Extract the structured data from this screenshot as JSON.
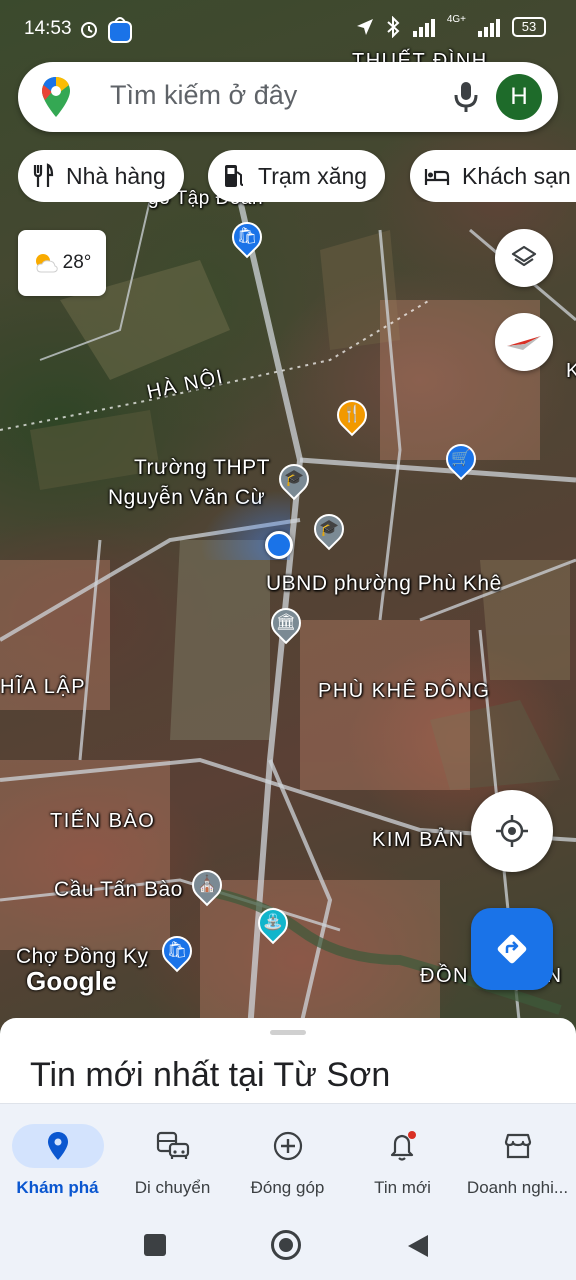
{
  "status_bar": {
    "time": "14:53",
    "network": "4G+",
    "battery": "53"
  },
  "search": {
    "placeholder": "Tìm kiếm ở đây",
    "avatar_letter": "H"
  },
  "chips": [
    {
      "label": "Nhà hàng",
      "icon": "restaurant-icon"
    },
    {
      "label": "Trạm xăng",
      "icon": "gas-station-icon"
    },
    {
      "label": "Khách sạn",
      "icon": "hotel-icon"
    }
  ],
  "weather": {
    "temperature": "28°",
    "icon": "partly-cloudy-icon"
  },
  "map": {
    "labels": {
      "thuet_binh": "THUẾT ĐÌNH",
      "go_tap_doan": "gỗ Tập Đoàn",
      "ha_noi": "HÀ NỘI",
      "school_line1": "Trường THPT",
      "school_line2": "Nguyễn Văn Cừ",
      "ubnd": "UBND phường Phù Khê",
      "nghia_lap": "HĨA LẬP",
      "phu_khe_dong": "PHÙ KHÊ ĐÔNG",
      "tien_bao": "TIẾN BÀO",
      "kim_bang": "KIM BẢN",
      "cau_tan_bao": "Cầu Tấn Bào",
      "cho_dong_ky": "Chợ Đồng Kỵ",
      "dong": "ĐỒN",
      "dong2": "ƠN",
      "edge_k": "K"
    },
    "google_logo": "Google"
  },
  "sheet": {
    "title": "Tin mới nhất tại Từ Sơn"
  },
  "nav": [
    {
      "label": "Khám phá",
      "icon": "explore-pin-icon",
      "active": true
    },
    {
      "label": "Di chuyển",
      "icon": "commute-icon",
      "active": false
    },
    {
      "label": "Đóng góp",
      "icon": "contribute-plus-icon",
      "active": false
    },
    {
      "label": "Tin mới",
      "icon": "notifications-bell-icon",
      "active": false
    },
    {
      "label": "Doanh nghi...",
      "icon": "business-store-icon",
      "active": false
    }
  ],
  "colors": {
    "accent": "#1a73e8",
    "nav_active": "#0b57d0",
    "nav_active_bg": "#d3e3fd",
    "avatar": "#1e6b2a",
    "poi_shopping": "#1a73e8",
    "poi_food": "#f29900",
    "poi_school": "#6e7f8a"
  }
}
